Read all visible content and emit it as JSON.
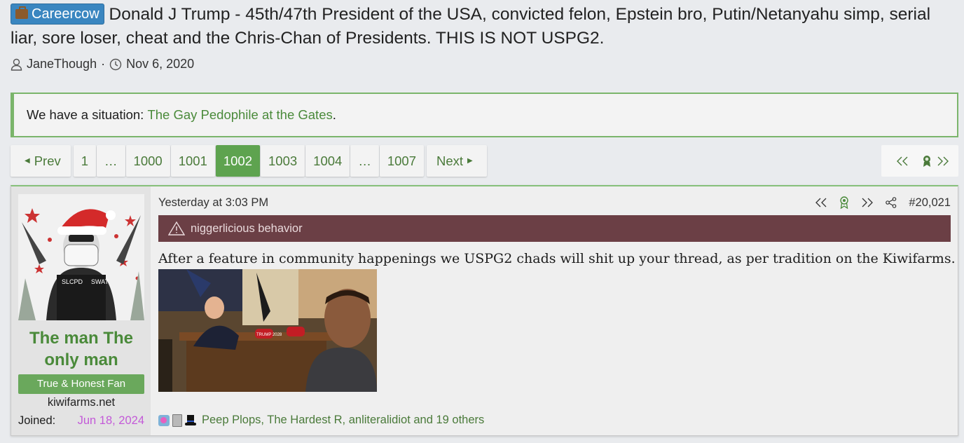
{
  "thread": {
    "prefix": "Careercow",
    "title": "Donald J Trump - 45th/47th President of the USA, convicted felon, Epstein bro, Putin/Netanyahu simp, serial liar, sore loser, cheat and the Chris-Chan of Presidents. THIS IS NOT USPG2.",
    "author": "JaneThough",
    "date": "Nov 6, 2020",
    "separator": "·"
  },
  "notice": {
    "lead": "We have a situation: ",
    "link": "The Gay Pedophile at the Gates",
    "tail": "."
  },
  "pagination": {
    "prev": "Prev",
    "next": "Next",
    "pages": [
      "1",
      "…",
      "1000",
      "1001",
      "1002",
      "1003",
      "1004",
      "…",
      "1007"
    ],
    "current": "1002"
  },
  "post": {
    "username": "The man The only man",
    "user_title": "True & Honest Fan",
    "user_banner": "kiwifarms.net",
    "joined_label": "Joined:",
    "joined_value": "Jun 18, 2024",
    "timestamp": "Yesterday at 3:03 PM",
    "post_number": "#20,021",
    "warning": "niggerlicious behavior",
    "body": "After a feature in community happenings we USPG2 chads will shit up your thread, as per tradition on the Kiwifarms.",
    "reactions_text": "Peep Plops, The Hardest R, anliteralidiot and 19 others",
    "avatar_badges": [
      "SLCPD",
      "SWAT"
    ],
    "photo_cap_text": "TRUMP 2028"
  },
  "icons": [
    "briefcase-icon",
    "user-icon",
    "clock-icon",
    "first-page-icon",
    "ribbon-icon",
    "last-page-icon",
    "share-icon",
    "warning-icon"
  ],
  "colors": {
    "accent_green": "#5ea34f",
    "link_green": "#4a8a3a",
    "prefix_blue": "#3a86c0",
    "warning_bg": "#6b3f45",
    "joined_purple": "#c35ad8"
  }
}
